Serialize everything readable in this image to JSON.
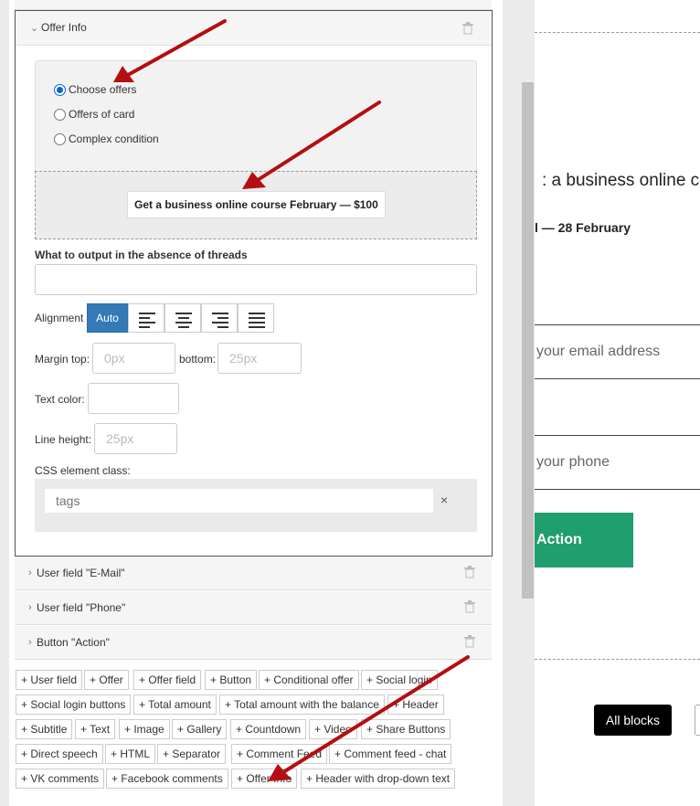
{
  "editor": {
    "offer_info": {
      "title": "Offer Info",
      "radio_options": [
        {
          "label": "Choose offers",
          "checked": true
        },
        {
          "label": "Offers of card",
          "checked": false
        },
        {
          "label": "Complex condition",
          "checked": false
        }
      ],
      "selected_offer": "Get a business online course February — $100",
      "absence_label": "What to output in the absence of threads",
      "absence_value": "",
      "alignment_label": "Alignment",
      "alignment_auto": "Auto",
      "alignment_options": [
        "align-left-icon",
        "align-center-icon",
        "align-right-icon",
        "align-justify-icon"
      ],
      "margin_top_label": "Margin top:",
      "margin_top_placeholder": "0px",
      "margin_bottom_label": "bottom:",
      "margin_bottom_placeholder": "25px",
      "text_color_label": "Text color:",
      "text_color_value": "",
      "line_height_label": "Line height:",
      "line_height_placeholder": "25px",
      "css_class_label": "CSS element class:",
      "tags_placeholder": "tags",
      "tags_clear": "×"
    },
    "collapsed_sections": [
      {
        "title": "User field \"E-Mail\""
      },
      {
        "title": "User field \"Phone\""
      },
      {
        "title": "Button \"Action\""
      }
    ],
    "add_buttons": [
      [
        "+ User field",
        "+ Offer",
        "+ Offer field",
        "+ Button",
        "+ Conditional offer",
        "+ Social login"
      ],
      [
        "+ Social login buttons",
        "+ Total amount",
        "+ Total amount with the balance",
        "+ Header"
      ],
      [
        "+ Subtitle",
        "+ Text",
        "+ Image",
        "+ Gallery",
        "+ Countdown",
        "+ Video",
        "+ Share Buttons"
      ],
      [
        "+ Direct speech",
        "+ HTML",
        "+ Separator",
        "+ Comment Feed",
        "+ Comment feed - chat"
      ],
      [
        "+ VK comments",
        "+ Facebook comments",
        "+ Offer Info",
        "+ Header with drop-down text"
      ]
    ]
  },
  "preview": {
    "title": ": a business online c",
    "date": "l — 28 February",
    "email_placeholder": "your email address",
    "phone_placeholder": "your phone",
    "action_label": "Action",
    "all_blocks_label": "All blocks"
  },
  "colors": {
    "accent_blue": "#337ab7",
    "action_green": "#1f9e6e",
    "arrow_red": "#b30f12"
  }
}
